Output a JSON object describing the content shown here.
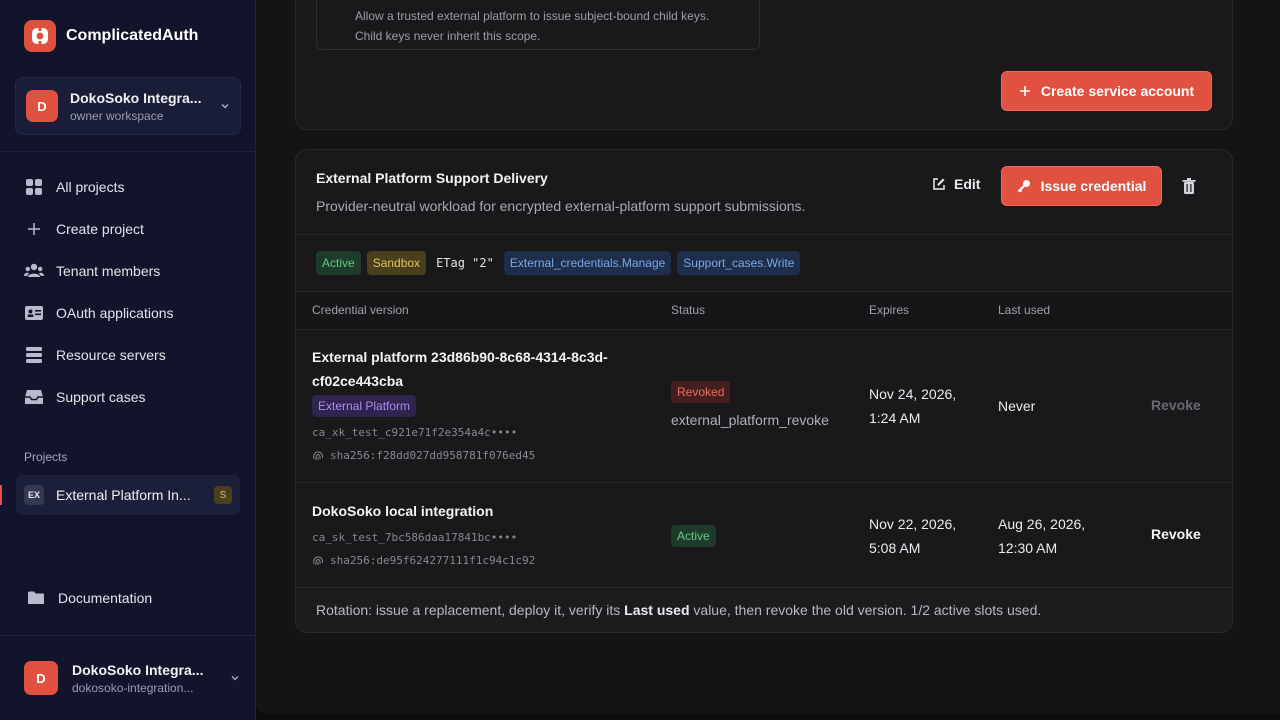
{
  "brand": {
    "name": "ComplicatedAuth",
    "accent": "#e0513f"
  },
  "workspace": {
    "avatar": "D",
    "title": "DokoSoko Integra...",
    "subtitle": "owner workspace"
  },
  "nav": [
    {
      "label": "All projects",
      "icon": "grid-icon"
    },
    {
      "label": "Create project",
      "icon": "plus-icon"
    },
    {
      "label": "Tenant members",
      "icon": "users-icon"
    },
    {
      "label": "OAuth applications",
      "icon": "id-card-icon"
    },
    {
      "label": "Resource servers",
      "icon": "server-icon"
    },
    {
      "label": "Support cases",
      "icon": "inbox-icon"
    }
  ],
  "projects": {
    "label": "Projects",
    "items": [
      {
        "badge": "EX",
        "name": "External Platform In...",
        "env": "S"
      }
    ]
  },
  "documentation": {
    "label": "Documentation",
    "icon": "folder-icon"
  },
  "user": {
    "avatar": "D",
    "name": "DokoSoko Integra...",
    "email": "dokosoko-integration..."
  },
  "top_card": {
    "scope_line1": "Allow a trusted external platform to issue subject-bound child keys.",
    "scope_line2": "Child keys never inherit this scope.",
    "create_button": "Create service account"
  },
  "service_account": {
    "title": "External Platform Support Delivery",
    "description": "Provider-neutral workload for encrypted external-platform support submissions.",
    "edit_label": "Edit",
    "issue_label": "Issue credential",
    "tags": {
      "status": "Active",
      "env": "Sandbox",
      "etag": "ETag \"2\"",
      "scope1": "External_credentials.Manage",
      "scope2": "Support_cases.Write"
    },
    "table": {
      "headers": {
        "version": "Credential version",
        "status": "Status",
        "expires": "Expires",
        "last_used": "Last used"
      },
      "rows": [
        {
          "name_line1": "External platform 23d86b90-8c68-4314-8c3d-",
          "name_line2": "cf02ce443cba",
          "label": "External Platform",
          "key": "ca_xk_test_c921e71f2e354a4c••••",
          "hash": "sha256:f28dd027dd958781f076ed45",
          "status": "Revoked",
          "status_reason": "external_platform_revoke",
          "expires_line1": "Nov 24, 2026,",
          "expires_line2": "1:24 AM",
          "last_used_line1": "Never",
          "action": "Revoke"
        },
        {
          "name_line1": "DokoSoko local integration",
          "key": "ca_sk_test_7bc586daa17841bc••••",
          "hash": "sha256:de95f624277111f1c94c1c92",
          "status": "Active",
          "expires_line1": "Nov 22, 2026,",
          "expires_line2": "5:08 AM",
          "last_used_line1": "Aug 26, 2026,",
          "last_used_line2": "12:30 AM",
          "action": "Revoke"
        }
      ]
    },
    "footer": {
      "before": "Rotation: issue a replacement, deploy it, verify its ",
      "bold": "Last used",
      "after": " value, then revoke the old version. 1/2 active slots used."
    }
  }
}
